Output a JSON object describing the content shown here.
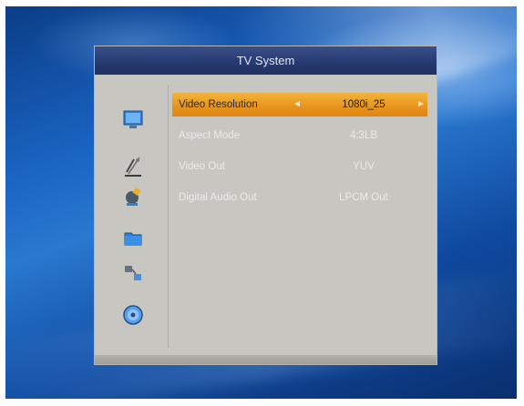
{
  "menu": {
    "title": "TV System",
    "icons": [
      "monitor-icon",
      "satellite-dish-icon",
      "tools-icon",
      "folder-icon",
      "network-icon",
      "disc-icon"
    ],
    "rows": [
      {
        "label": "Video Resolution",
        "value": "1080i_25",
        "selected": true
      },
      {
        "label": "Aspect Mode",
        "value": "4:3LB",
        "selected": false
      },
      {
        "label": "Video Out",
        "value": "YUV",
        "selected": false
      },
      {
        "label": "Digital Audio Out",
        "value": "LPCM Out",
        "selected": false
      }
    ],
    "arrows": {
      "left": "◄",
      "right": "►"
    }
  },
  "colors": {
    "highlight": "#e8961e",
    "title_bar": "#273a72",
    "panel": "#c7c6c1",
    "background": "#1a64c2"
  }
}
